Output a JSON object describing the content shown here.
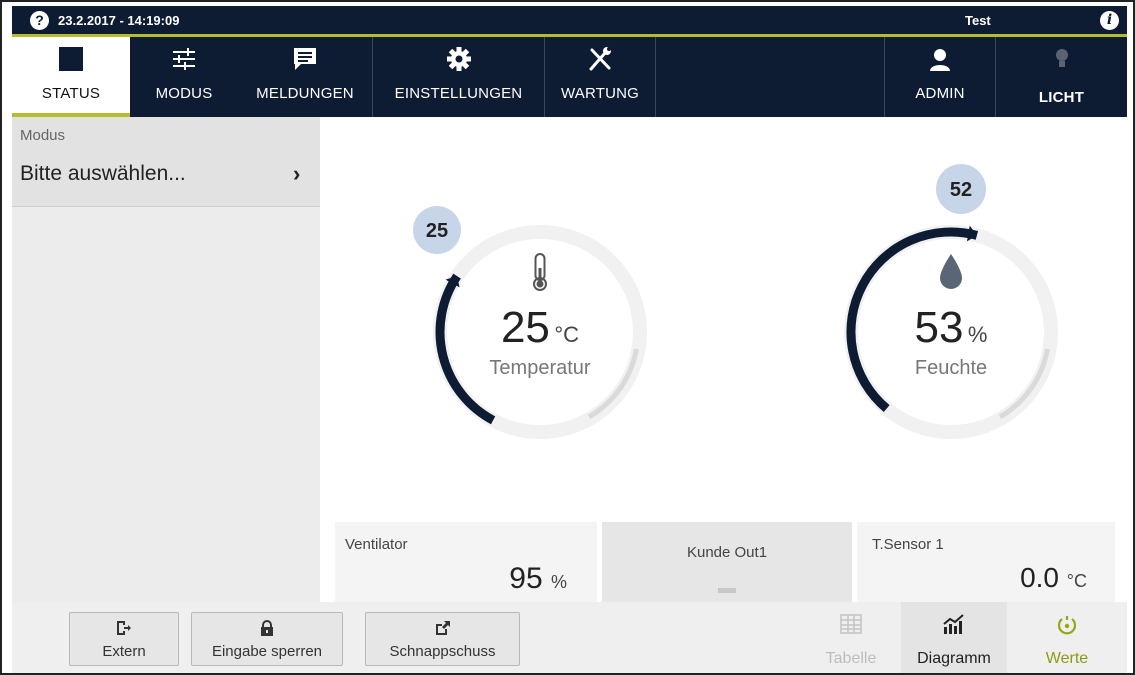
{
  "topbar": {
    "help_icon": "?",
    "datetime": "23.2.2017 - 14:19:09",
    "device_name": "Test",
    "info_icon": "i"
  },
  "nav": {
    "items": [
      {
        "label": "STATUS",
        "icon": "status-square-icon",
        "active": true
      },
      {
        "label": "MODUS",
        "icon": "sliders-icon"
      },
      {
        "label": "MELDUNGEN",
        "icon": "message-icon"
      },
      {
        "label": "EINSTELLUNGEN",
        "icon": "gear-icon"
      },
      {
        "label": "WARTUNG",
        "icon": "tools-icon"
      },
      {
        "label": "ADMIN",
        "icon": "user-icon"
      },
      {
        "label": "LICHT",
        "icon": "lightbulb-icon"
      }
    ]
  },
  "sidebar": {
    "modus_title": "Modus",
    "modus_value": "Bitte auswählen...",
    "chevron": "›"
  },
  "gauges": {
    "temperature": {
      "value": "25",
      "unit": "°C",
      "name": "Temperatur",
      "setpoint": "25",
      "level": 0.25,
      "icon": "thermometer-icon"
    },
    "humidity": {
      "value": "53",
      "unit": "%",
      "name": "Feuchte",
      "setpoint": "52",
      "level": 0.53,
      "icon": "droplet-icon"
    }
  },
  "tiles": {
    "ventilator": {
      "label": "Ventilator",
      "value": "95",
      "unit": "%"
    },
    "kunde_out1": {
      "label": "Kunde Out1"
    },
    "tsensor1": {
      "label": "T.Sensor 1",
      "value": "0.0",
      "unit": "°C"
    }
  },
  "bottom": {
    "buttons": [
      {
        "label": "Extern",
        "icon": "exit-icon"
      },
      {
        "label": "Eingabe sperren",
        "icon": "lock-icon"
      },
      {
        "label": "Schnappschuss",
        "icon": "share-icon"
      }
    ],
    "views": [
      {
        "label": "Tabelle",
        "icon": "table-icon",
        "disabled": true
      },
      {
        "label": "Diagramm",
        "icon": "chart-icon"
      },
      {
        "label": "Werte",
        "icon": "gauge-icon",
        "active": true
      }
    ]
  },
  "colors": {
    "navbar": "#0d1b33",
    "accent": "#b5bd2d",
    "gauge_arc": "#0d1b33",
    "setpoint_badge": "#c7d5e8"
  }
}
